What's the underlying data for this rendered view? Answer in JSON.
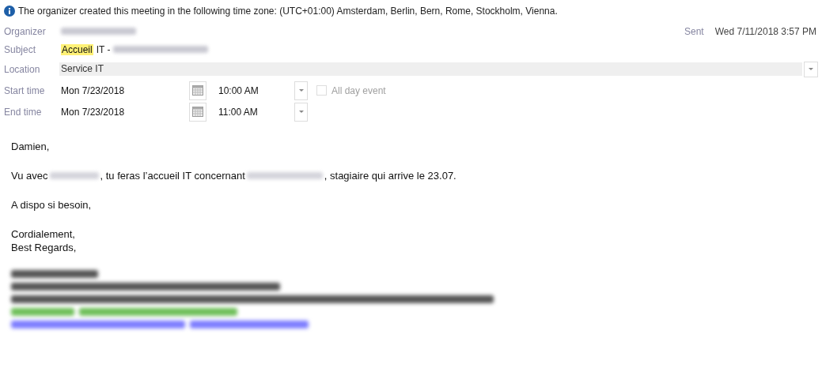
{
  "info_bar": {
    "text": "The organizer created this meeting in the following time zone: (UTC+01:00) Amsterdam, Berlin, Bern, Rome, Stockholm, Vienna."
  },
  "header": {
    "organizer": {
      "label": "Organizer",
      "value": [
        {
          "kind": "redacted"
        }
      ]
    },
    "sent": {
      "label": "Sent",
      "value": "Wed 7/11/2018 3:57 PM"
    },
    "subject": {
      "label": "Subject",
      "value": [
        {
          "kind": "highlight",
          "text": "Accueil"
        },
        {
          "kind": "text",
          "text": "IT -"
        },
        {
          "kind": "redacted"
        }
      ]
    },
    "location": {
      "label": "Location",
      "value": "Service IT"
    },
    "start": {
      "label": "Start time",
      "date": "Mon 7/23/2018",
      "time": "10:00 AM"
    },
    "end": {
      "label": "End time",
      "date": "Mon 7/23/2018",
      "time": "11:00 AM"
    },
    "all_day": {
      "label": "All day event",
      "checked": false,
      "disabled": true
    }
  },
  "body": [
    [
      {
        "kind": "text",
        "text": "Damien,"
      }
    ],
    [
      {
        "kind": "text",
        "text": "Vu avec"
      },
      {
        "kind": "redacted"
      },
      {
        "kind": "text",
        "text": ", tu feras l’accueil IT concernant"
      },
      {
        "kind": "redacted"
      },
      {
        "kind": "text",
        "text": ", stagiaire qui arrive le 23.07."
      }
    ],
    [
      {
        "kind": "text",
        "text": "A dispo si besoin,"
      }
    ],
    [
      {
        "kind": "text",
        "text": "Cordialement,"
      },
      {
        "kind": "break"
      },
      {
        "kind": "text",
        "text": "Best Regards,"
      }
    ]
  ],
  "signature": [
    {
      "kind": "redacted",
      "color": "#555555"
    },
    {
      "kind": "redacted",
      "color": "#555555"
    },
    {
      "kind": "redacted",
      "color": "#555555"
    },
    {
      "kind": "redacted",
      "color": "#6fbf5a"
    },
    {
      "kind": "redacted",
      "color": "#7d7dff"
    }
  ]
}
